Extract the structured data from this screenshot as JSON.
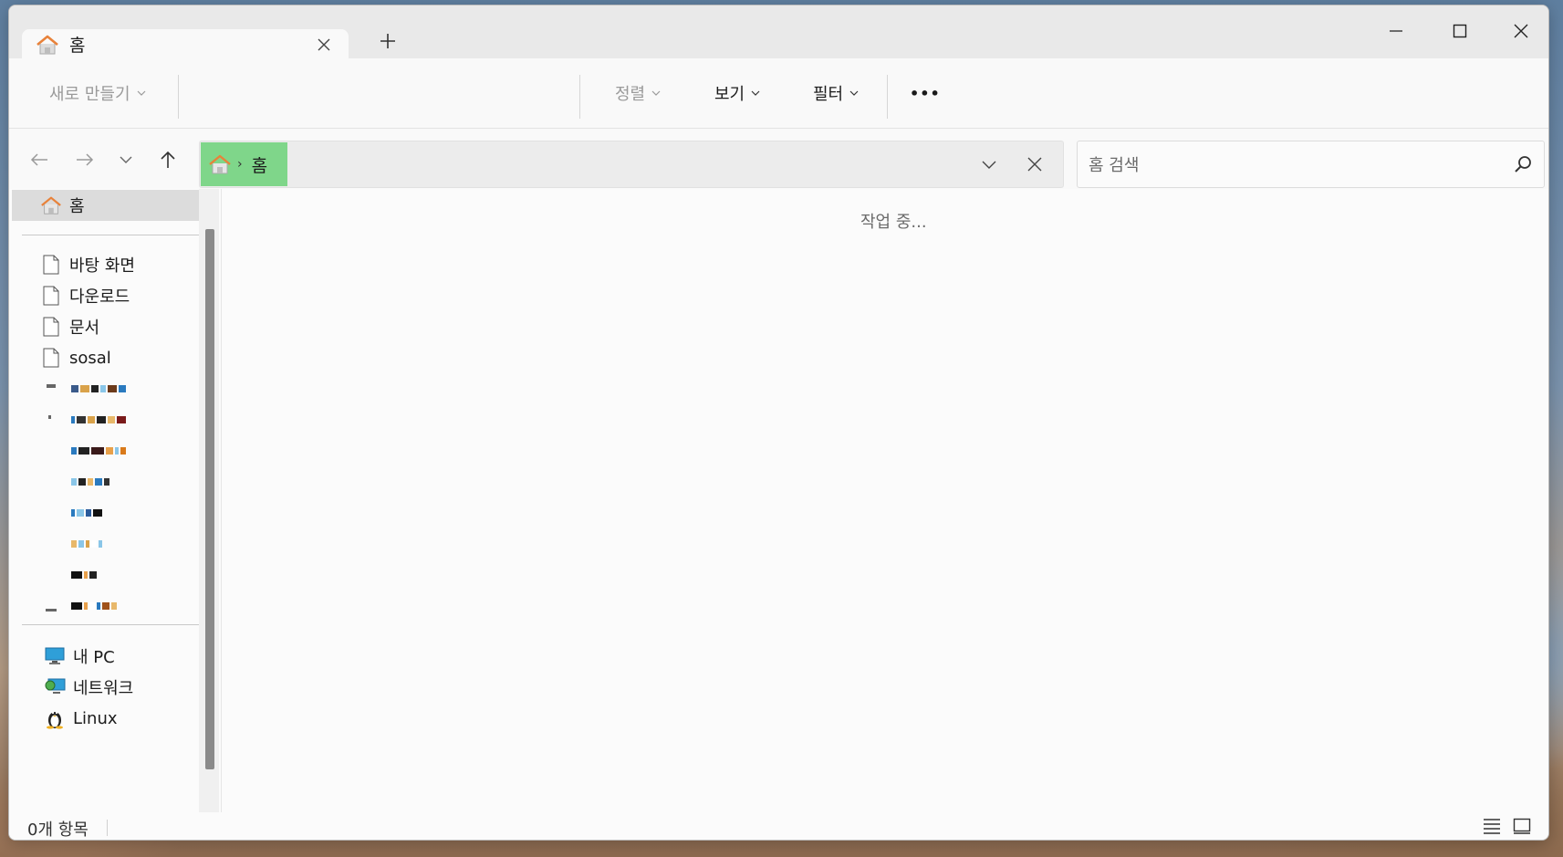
{
  "tab": {
    "title": "홈"
  },
  "toolbar": {
    "new_label": "새로 만들기",
    "sort_label": "정렬",
    "view_label": "보기",
    "filter_label": "필터",
    "more_label": "•••"
  },
  "address": {
    "crumb_sep": "›",
    "crumb_label": "홈"
  },
  "search": {
    "placeholder": "홈 검색",
    "value": ""
  },
  "sidebar": {
    "home_label": "홈",
    "quick_items": [
      {
        "label": "바탕 화면",
        "icon": "document-icon"
      },
      {
        "label": "다운로드",
        "icon": "document-icon"
      },
      {
        "label": "문서",
        "icon": "document-icon"
      },
      {
        "label": "sosal",
        "icon": "document-icon"
      }
    ],
    "system_items": [
      {
        "label": "내 PC",
        "icon": "pc-icon"
      },
      {
        "label": "네트워크",
        "icon": "network-icon"
      },
      {
        "label": "Linux",
        "icon": "linux-icon"
      }
    ]
  },
  "content": {
    "status_message": "작업 중..."
  },
  "statusbar": {
    "item_count": "0개 항목"
  },
  "colors": {
    "breadcrumb_highlight": "#7fd68a",
    "home_icon": "#e8823a",
    "selection": "#dcdcdc"
  }
}
